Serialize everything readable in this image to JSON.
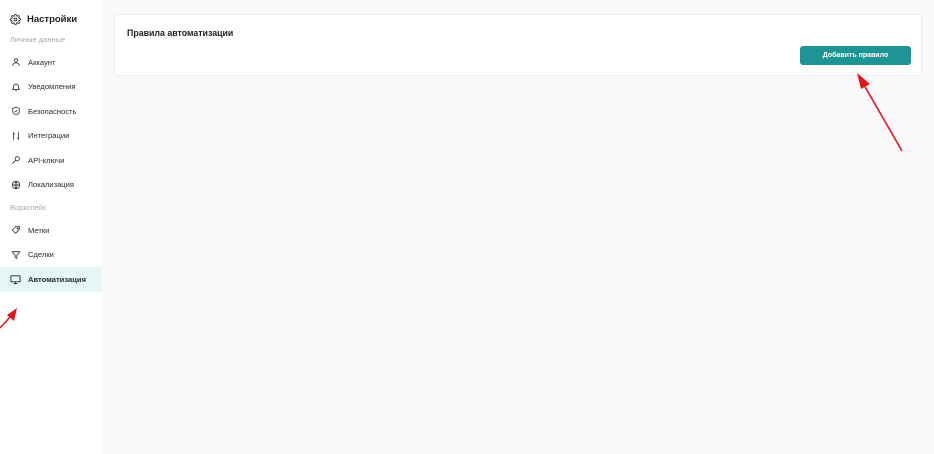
{
  "sidebar": {
    "title": "Настройки",
    "title_icon": "gear-icon",
    "section_personal": "Личные данные",
    "section_workspace": "Воркспейс",
    "items": [
      {
        "label": "Аккаунт",
        "icon": "user-icon"
      },
      {
        "label": "Уведомления",
        "icon": "bell-icon"
      },
      {
        "label": "Безопасность",
        "icon": "shield-icon"
      },
      {
        "label": "Интеграции",
        "icon": "integration-icon"
      },
      {
        "label": "API-ключи",
        "icon": "key-icon"
      },
      {
        "label": "Локализация",
        "icon": "globe-icon"
      },
      {
        "label": "Метки",
        "icon": "tag-icon"
      },
      {
        "label": "Сделки",
        "icon": "funnel-icon"
      },
      {
        "label": "Автоматизация",
        "icon": "monitor-icon",
        "active": true
      }
    ]
  },
  "main": {
    "card_title": "Правила автоматизации",
    "add_button_label": "Добавить правило"
  },
  "colors": {
    "accent": "#1e9594",
    "active_bg": "#e6f6f7",
    "main_bg": "#f9f9f9",
    "annotation_arrow": "#e8141b"
  }
}
